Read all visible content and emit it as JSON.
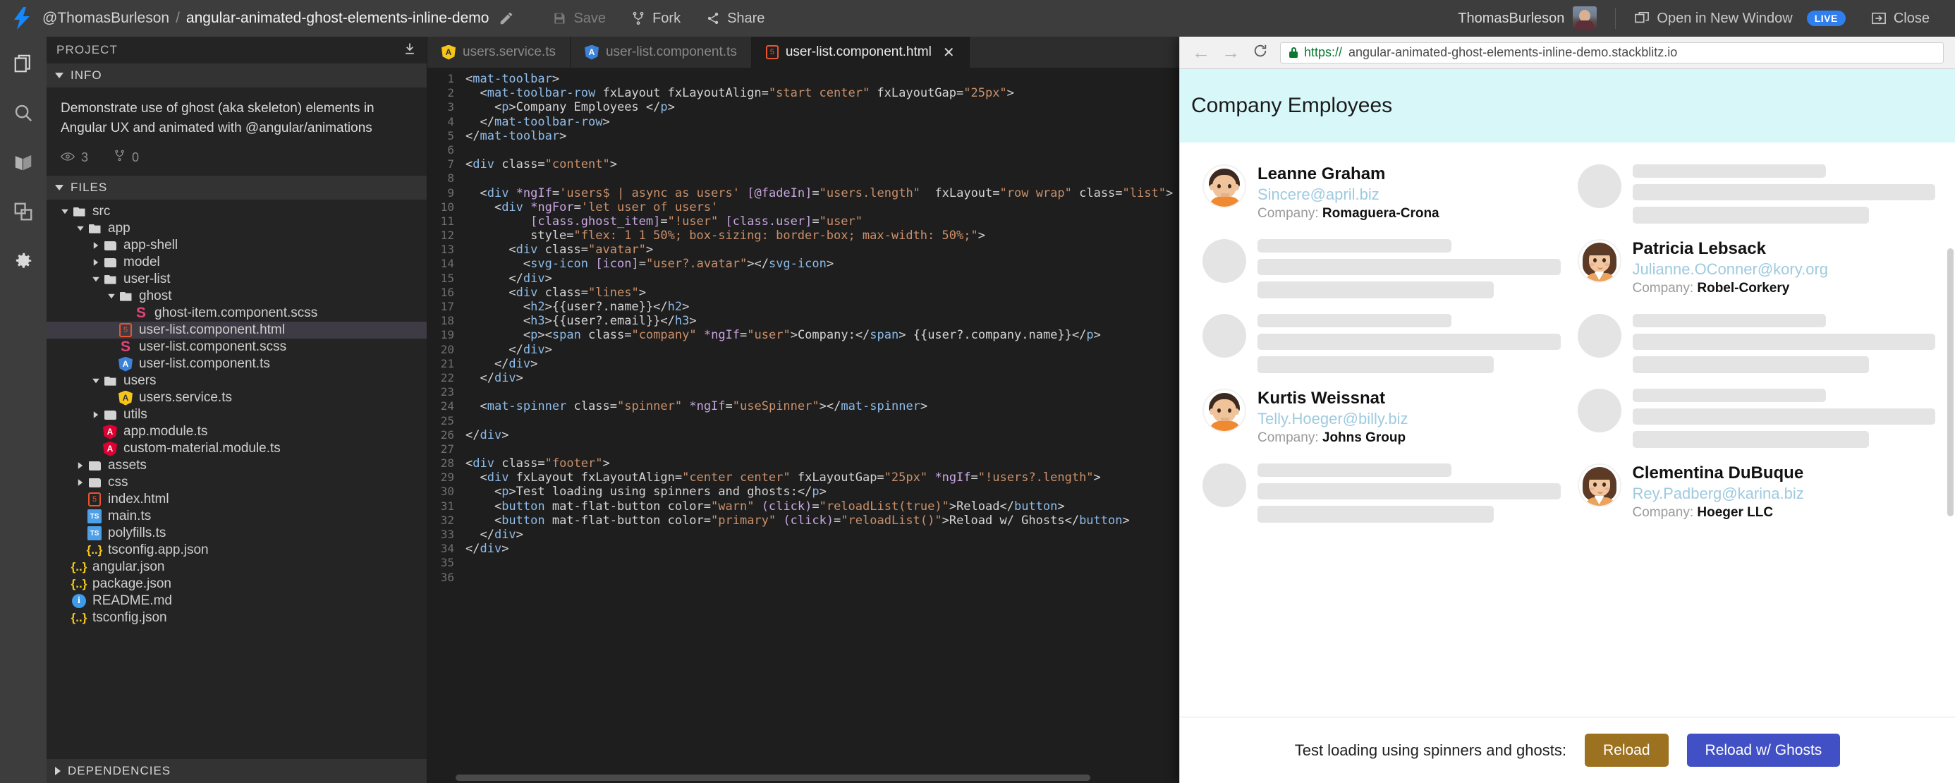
{
  "topbar": {
    "logo": "bolt-icon",
    "user_handle": "@ThomasBurleson",
    "separator": "/",
    "project_name": "angular-animated-ghost-elements-inline-demo",
    "edit_icon": "pencil-icon",
    "save_label": "Save",
    "fork_label": "Fork",
    "share_label": "Share",
    "account_name": "ThomasBurleson",
    "open_new_window_label": "Open in New Window",
    "live_badge": "LIVE",
    "close_label": "Close"
  },
  "rail": {
    "items": [
      {
        "icon": "files-icon",
        "name": "files"
      },
      {
        "icon": "search-icon",
        "name": "search"
      },
      {
        "icon": "book-icon",
        "name": "docs"
      },
      {
        "icon": "dependencies-icon",
        "name": "dependencies"
      },
      {
        "icon": "gear-icon",
        "name": "settings"
      }
    ]
  },
  "project": {
    "header": "PROJECT",
    "download_icon": "download-icon",
    "info_header": "INFO",
    "description": "Demonstrate use of ghost (aka skeleton) elements in Angular UX and animated with @angular/animations",
    "views_count": "3",
    "forks_count": "0",
    "files_header": "FILES",
    "dependencies_header": "DEPENDENCIES",
    "tree": [
      {
        "label": "src",
        "depth": 0,
        "type": "folder-open",
        "arrow": "down"
      },
      {
        "label": "app",
        "depth": 1,
        "type": "folder-open",
        "arrow": "down"
      },
      {
        "label": "app-shell",
        "depth": 2,
        "type": "folder",
        "arrow": "right"
      },
      {
        "label": "model",
        "depth": 2,
        "type": "folder",
        "arrow": "right"
      },
      {
        "label": "user-list",
        "depth": 2,
        "type": "folder-open",
        "arrow": "down"
      },
      {
        "label": "ghost",
        "depth": 3,
        "type": "folder-open",
        "arrow": "down"
      },
      {
        "label": "ghost-item.component.scss",
        "depth": 4,
        "type": "scss",
        "arrow": ""
      },
      {
        "label": "user-list.component.html",
        "depth": 3,
        "type": "html",
        "arrow": "",
        "selected": true
      },
      {
        "label": "user-list.component.scss",
        "depth": 3,
        "type": "scss",
        "arrow": ""
      },
      {
        "label": "user-list.component.ts",
        "depth": 3,
        "type": "ng-blue",
        "arrow": ""
      },
      {
        "label": "users",
        "depth": 2,
        "type": "folder-open",
        "arrow": "down"
      },
      {
        "label": "users.service.ts",
        "depth": 3,
        "type": "ng-yellow",
        "arrow": ""
      },
      {
        "label": "utils",
        "depth": 2,
        "type": "folder",
        "arrow": "right"
      },
      {
        "label": "app.module.ts",
        "depth": 2,
        "type": "ng-red",
        "arrow": ""
      },
      {
        "label": "custom-material.module.ts",
        "depth": 2,
        "type": "ng-red",
        "arrow": ""
      },
      {
        "label": "assets",
        "depth": 1,
        "type": "folder",
        "arrow": "right"
      },
      {
        "label": "css",
        "depth": 1,
        "type": "folder",
        "arrow": "right"
      },
      {
        "label": "index.html",
        "depth": 1,
        "type": "html",
        "arrow": ""
      },
      {
        "label": "main.ts",
        "depth": 1,
        "type": "ts",
        "arrow": ""
      },
      {
        "label": "polyfills.ts",
        "depth": 1,
        "type": "ts",
        "arrow": ""
      },
      {
        "label": "tsconfig.app.json",
        "depth": 1,
        "type": "json",
        "arrow": ""
      },
      {
        "label": "angular.json",
        "depth": 0,
        "type": "json",
        "arrow": ""
      },
      {
        "label": "package.json",
        "depth": 0,
        "type": "json",
        "arrow": ""
      },
      {
        "label": "README.md",
        "depth": 0,
        "type": "md",
        "arrow": ""
      },
      {
        "label": "tsconfig.json",
        "depth": 0,
        "type": "json",
        "arrow": ""
      }
    ]
  },
  "editor": {
    "tabs": [
      {
        "label": "users.service.ts",
        "icon": "ng-yellow",
        "active": false,
        "closable": false
      },
      {
        "label": "user-list.component.ts",
        "icon": "ng-blue",
        "active": false,
        "closable": false
      },
      {
        "label": "user-list.component.html",
        "icon": "html",
        "active": true,
        "closable": true
      }
    ],
    "close_glyph": "✕",
    "toolbar_icons": [
      "format-icon",
      "split-editor-icon",
      "more-options-icon"
    ],
    "lines": [
      {
        "n": 1,
        "text": "<mat-toolbar>"
      },
      {
        "n": 2,
        "text": "  <mat-toolbar-row fxLayout fxLayoutAlign=\"start center\" fxLayoutGap=\"25px\">"
      },
      {
        "n": 3,
        "text": "    <p>Company Employees </p>"
      },
      {
        "n": 4,
        "text": "  </mat-toolbar-row>"
      },
      {
        "n": 5,
        "text": "</mat-toolbar>"
      },
      {
        "n": 6,
        "text": ""
      },
      {
        "n": 7,
        "text": "<div class=\"content\">"
      },
      {
        "n": 8,
        "text": ""
      },
      {
        "n": 9,
        "text": "  <div *ngIf='users$ | async as users' [@fadeIn]=\"users.length\"  fxLayout=\"row wrap\" class=\"list\">"
      },
      {
        "n": 10,
        "text": "    <div *ngFor='let user of users'"
      },
      {
        "n": 11,
        "text": "         [class.ghost_item]=\"!user\" [class.user]=\"user\""
      },
      {
        "n": 12,
        "text": "         style=\"flex: 1 1 50%; box-sizing: border-box; max-width: 50%;\">"
      },
      {
        "n": 13,
        "text": "      <div class=\"avatar\">"
      },
      {
        "n": 14,
        "text": "        <svg-icon [icon]=\"user?.avatar\"></svg-icon>"
      },
      {
        "n": 15,
        "text": "      </div>"
      },
      {
        "n": 16,
        "text": "      <div class=\"lines\">"
      },
      {
        "n": 17,
        "text": "        <h2>{{user?.name}}</h2>"
      },
      {
        "n": 18,
        "text": "        <h3>{{user?.email}}</h3>"
      },
      {
        "n": 19,
        "text": "        <p><span class=\"company\" *ngIf=\"user\">Company:</span> {{user?.company.name}}</p>"
      },
      {
        "n": 20,
        "text": "      </div>"
      },
      {
        "n": 21,
        "text": "    </div>"
      },
      {
        "n": 22,
        "text": "  </div>"
      },
      {
        "n": 23,
        "text": ""
      },
      {
        "n": 24,
        "text": "  <mat-spinner class=\"spinner\" *ngIf=\"useSpinner\"></mat-spinner>"
      },
      {
        "n": 25,
        "text": ""
      },
      {
        "n": 26,
        "text": "</div>"
      },
      {
        "n": 27,
        "text": ""
      },
      {
        "n": 28,
        "text": "<div class=\"footer\">"
      },
      {
        "n": 29,
        "text": "  <div fxLayout fxLayoutAlign=\"center center\" fxLayoutGap=\"25px\" *ngIf=\"!users?.length\">"
      },
      {
        "n": 30,
        "text": "    <p>Test loading using spinners and ghosts:</p>"
      },
      {
        "n": 31,
        "text": "    <button mat-flat-button color=\"warn\" (click)=\"reloadList(true)\">Reload</button>"
      },
      {
        "n": 32,
        "text": "    <button mat-flat-button color=\"primary\" (click)=\"reloadList()\">Reload w/ Ghosts</button>"
      },
      {
        "n": 33,
        "text": "  </div>"
      },
      {
        "n": 34,
        "text": "</div>"
      },
      {
        "n": 35,
        "text": ""
      },
      {
        "n": 36,
        "text": ""
      }
    ]
  },
  "preview": {
    "back_icon": "arrow-left-icon",
    "forward_icon": "arrow-right-icon",
    "reload_icon": "reload-icon",
    "lock_icon": "lock-icon",
    "url_protocol": "https://",
    "url_rest": "angular-animated-ghost-elements-inline-demo.stackblitz.io",
    "url_full": "https://angular-animated-ghost-elements-inline-demo.stackblitz.io",
    "app_title": "Company Employees",
    "company_label": "Company:",
    "items": [
      {
        "kind": "user",
        "avatar": "male",
        "name": "Leanne Graham",
        "email": "Sincere@april.biz",
        "company": "Romaguera-Crona"
      },
      {
        "kind": "ghost"
      },
      {
        "kind": "ghost"
      },
      {
        "kind": "user",
        "avatar": "female",
        "name": "Patricia Lebsack",
        "email": "Julianne.OConner@kory.org",
        "company": "Robel-Corkery"
      },
      {
        "kind": "ghost"
      },
      {
        "kind": "ghost"
      },
      {
        "kind": "user",
        "avatar": "male",
        "name": "Kurtis Weissnat",
        "email": "Telly.Hoeger@billy.biz",
        "company": "Johns Group"
      },
      {
        "kind": "ghost"
      },
      {
        "kind": "ghost"
      },
      {
        "kind": "user",
        "avatar": "female",
        "name": "Clementina DuBuque",
        "email": "Rey.Padberg@karina.biz",
        "company": "Hoeger LLC"
      }
    ],
    "footer_text": "Test loading using spinners and ghosts:",
    "reload_label": "Reload",
    "reload_ghosts_label": "Reload w/ Ghosts",
    "colors": {
      "toolbar_bg": "#d8f7f8",
      "email": "#9ecadf",
      "ghost": "#e4e4e4",
      "warn_button": "#9c7220",
      "primary_button": "#4150c4"
    }
  }
}
